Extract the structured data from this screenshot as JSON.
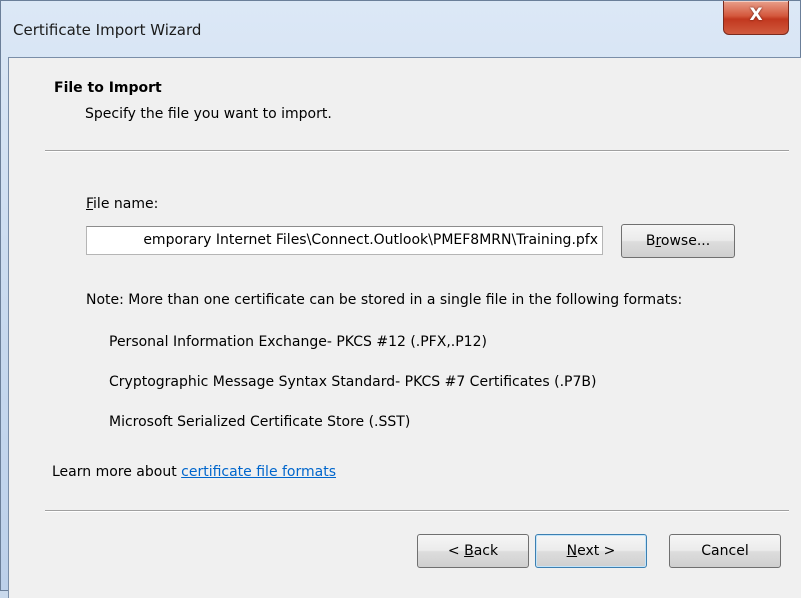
{
  "window": {
    "title": "Certificate Import Wizard",
    "close_label": "X"
  },
  "header": {
    "title": "File to Import",
    "subtitle": "Specify the file you want to import."
  },
  "file_name": {
    "label_accel": "F",
    "label_rest": "ile name:",
    "value": "emporary Internet Files\\Connect.Outlook\\PMEF8MRN\\Training.pfx",
    "browse_accel": "r",
    "browse_pre": "B",
    "browse_post": "owse..."
  },
  "note": {
    "text": "Note:  More than one certificate can be stored in a single file in the following formats:",
    "formats": [
      "Personal Information Exchange- PKCS #12 (.PFX,.P12)",
      "Cryptographic Message Syntax Standard- PKCS #7 Certificates (.P7B)",
      "Microsoft Serialized Certificate Store (.SST)"
    ]
  },
  "learn_more": {
    "prefix": "Learn more about ",
    "link": "certificate file formats"
  },
  "footer": {
    "back_pre": "< ",
    "back_accel": "B",
    "back_post": "ack",
    "next_accel": "N",
    "next_post": "ext >",
    "cancel": "Cancel"
  }
}
